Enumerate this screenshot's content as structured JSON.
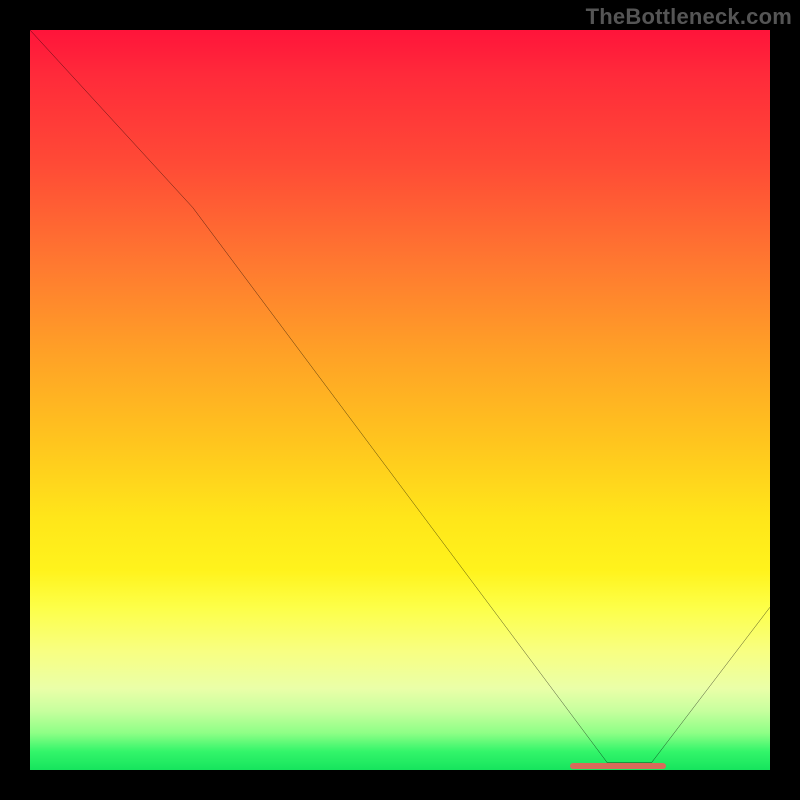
{
  "watermark": "TheBottleneck.com",
  "chart_data": {
    "type": "line",
    "title": "",
    "xlabel": "",
    "ylabel": "",
    "xlim": [
      0,
      100
    ],
    "ylim": [
      0,
      100
    ],
    "annotations": [],
    "series": [
      {
        "name": "curve",
        "x": [
          0,
          22,
          78,
          84,
          100
        ],
        "values": [
          100,
          76,
          1,
          1,
          22
        ]
      }
    ],
    "heatmap_background": {
      "direction": "vertical",
      "stops": [
        {
          "pos": 0,
          "color": "#ff143a"
        },
        {
          "pos": 50,
          "color": "#ffb822"
        },
        {
          "pos": 75,
          "color": "#fff31c"
        },
        {
          "pos": 95,
          "color": "#8eff86"
        },
        {
          "pos": 100,
          "color": "#16e45d"
        }
      ]
    },
    "optimum_marker": {
      "x_start": 73,
      "x_end": 86,
      "y": 0.6,
      "color": "#d86b5a"
    }
  }
}
